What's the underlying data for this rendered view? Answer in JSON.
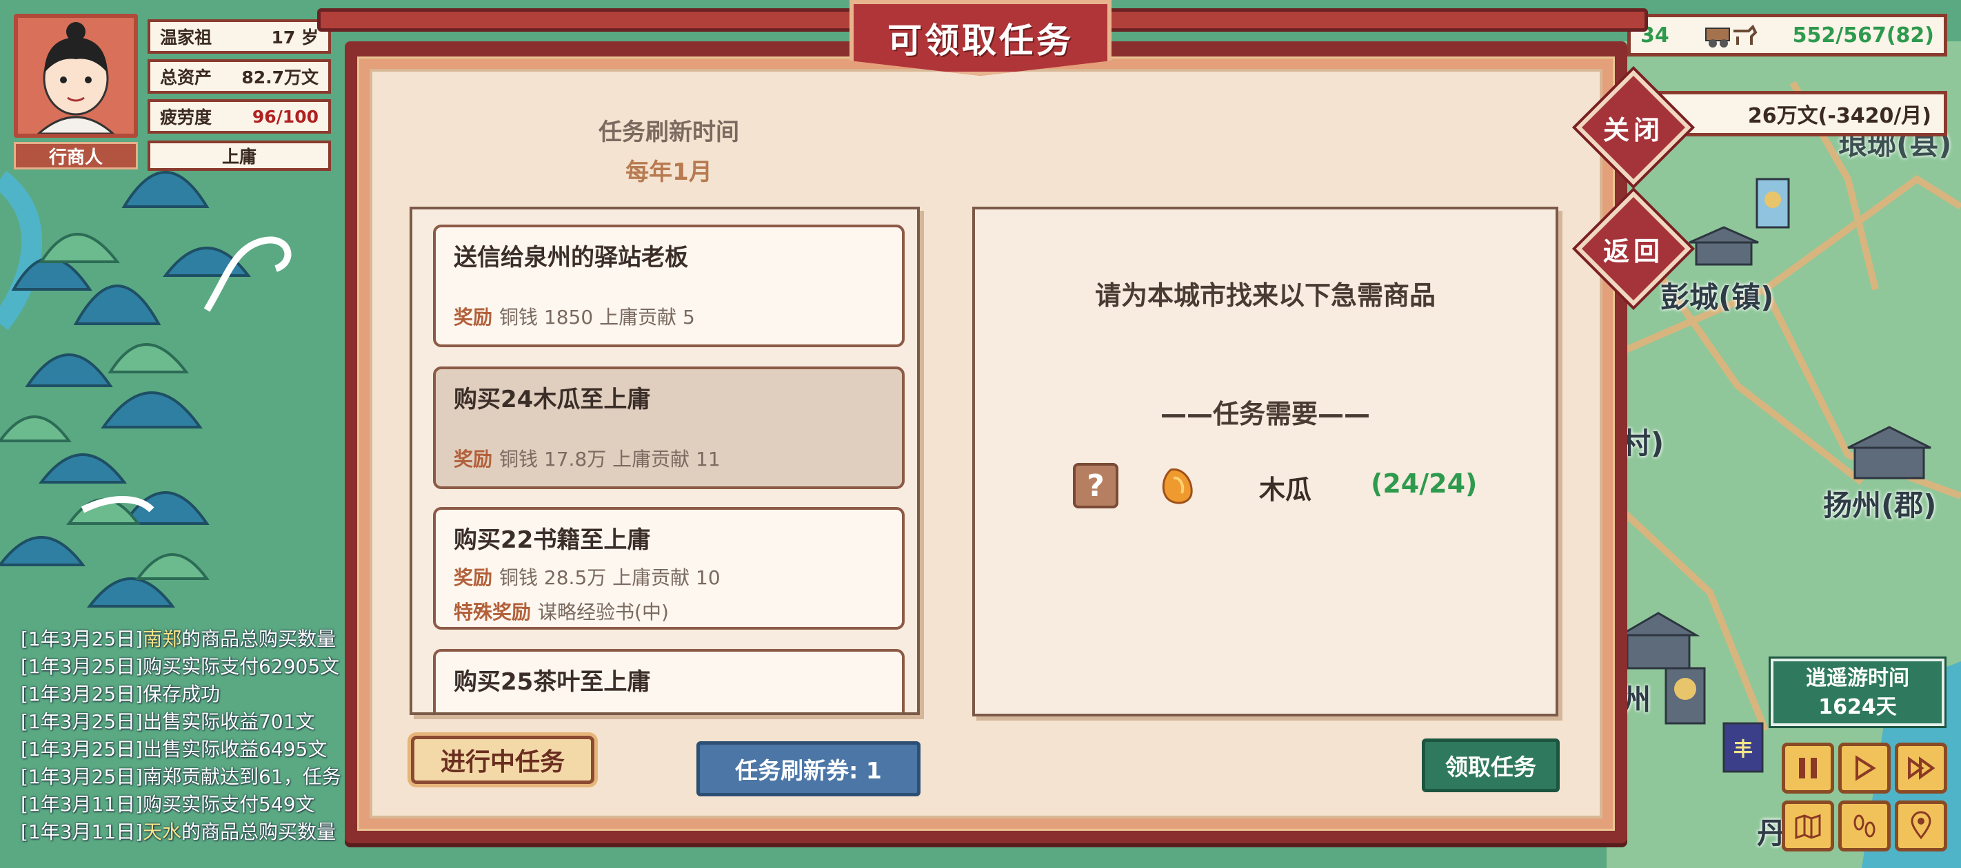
{
  "player": {
    "name": "温家祖",
    "age": "17 岁",
    "assets_label": "总资产",
    "assets_value": "82.7万文",
    "fatigue_label": "疲劳度",
    "fatigue_value": "96/100",
    "profession": "行商人",
    "city": "上庸"
  },
  "resources": {
    "left_partial": "34",
    "cargo": "552/567(82)",
    "money": "26万文(-3420/月)"
  },
  "dialog": {
    "title": "可领取任务",
    "refresh_label": "任务刷新时间",
    "refresh_value": "每年1月",
    "close_label": "关闭",
    "back_label": "返回",
    "tasks": [
      {
        "title": "送信给泉州的驿站老板",
        "reward_label": "奖励",
        "reward": "铜钱 1850 上庸贡献 5"
      },
      {
        "title": "购买24木瓜至上庸",
        "reward_label": "奖励",
        "reward": "铜钱 17.8万 上庸贡献 11"
      },
      {
        "title": "购买22书籍至上庸",
        "reward_label": "奖励",
        "reward": "铜钱 28.5万 上庸贡献 10",
        "special_label": "特殊奖励",
        "special": "谋略经验书(中)"
      },
      {
        "title": "购买25茶叶至上庸"
      }
    ],
    "detail": {
      "title": "请为本城市找来以下急需商品",
      "need_title": "——任务需要——",
      "item_name": "木瓜",
      "item_qty": "(24/24)"
    },
    "btn_ongoing": "进行中任务",
    "btn_refresh": "任务刷新券: 1",
    "btn_accept": "领取任务"
  },
  "log": [
    {
      "date": "[1年3月25日]",
      "place": "南郑",
      "text": "的商品总购买数量"
    },
    {
      "date": "[1年3月25日]",
      "place": "",
      "text": "购买实际支付62905文"
    },
    {
      "date": "[1年3月25日]",
      "place": "",
      "text": "保存成功"
    },
    {
      "date": "[1年3月25日]",
      "place": "",
      "text": "出售实际收益701文"
    },
    {
      "date": "[1年3月25日]",
      "place": "",
      "text": "出售实际收益6495文"
    },
    {
      "date": "[1年3月25日]",
      "place": "",
      "text": "南郑贡献达到61，任务"
    },
    {
      "date": "[1年3月11日]",
      "place": "",
      "text": "购买实际支付549文"
    },
    {
      "date": "[1年3月11日]",
      "place": "天水",
      "text": "的商品总购买数量"
    }
  ],
  "map": {
    "cities": [
      "彭城(镇)",
      "扬州(郡)",
      "琅琊(县)",
      "村)",
      "州",
      "丹"
    ],
    "flag_label": "丰"
  },
  "travel": {
    "label": "逍遥游时间",
    "days": "1624天"
  },
  "icons": {
    "pause": "pause-icon",
    "play": "play-icon",
    "fast": "fast-forward-icon",
    "map": "map-icon",
    "footprints": "footprints-icon",
    "location": "location-pin-icon"
  },
  "colors": {
    "dialog_frame": "#8b2e2e",
    "title_red": "#b03539",
    "reward_orange": "#b2603a",
    "qty_green": "#2e9a4e",
    "accept_green": "#2f7a5e",
    "refresh_blue": "#4b76a6"
  }
}
